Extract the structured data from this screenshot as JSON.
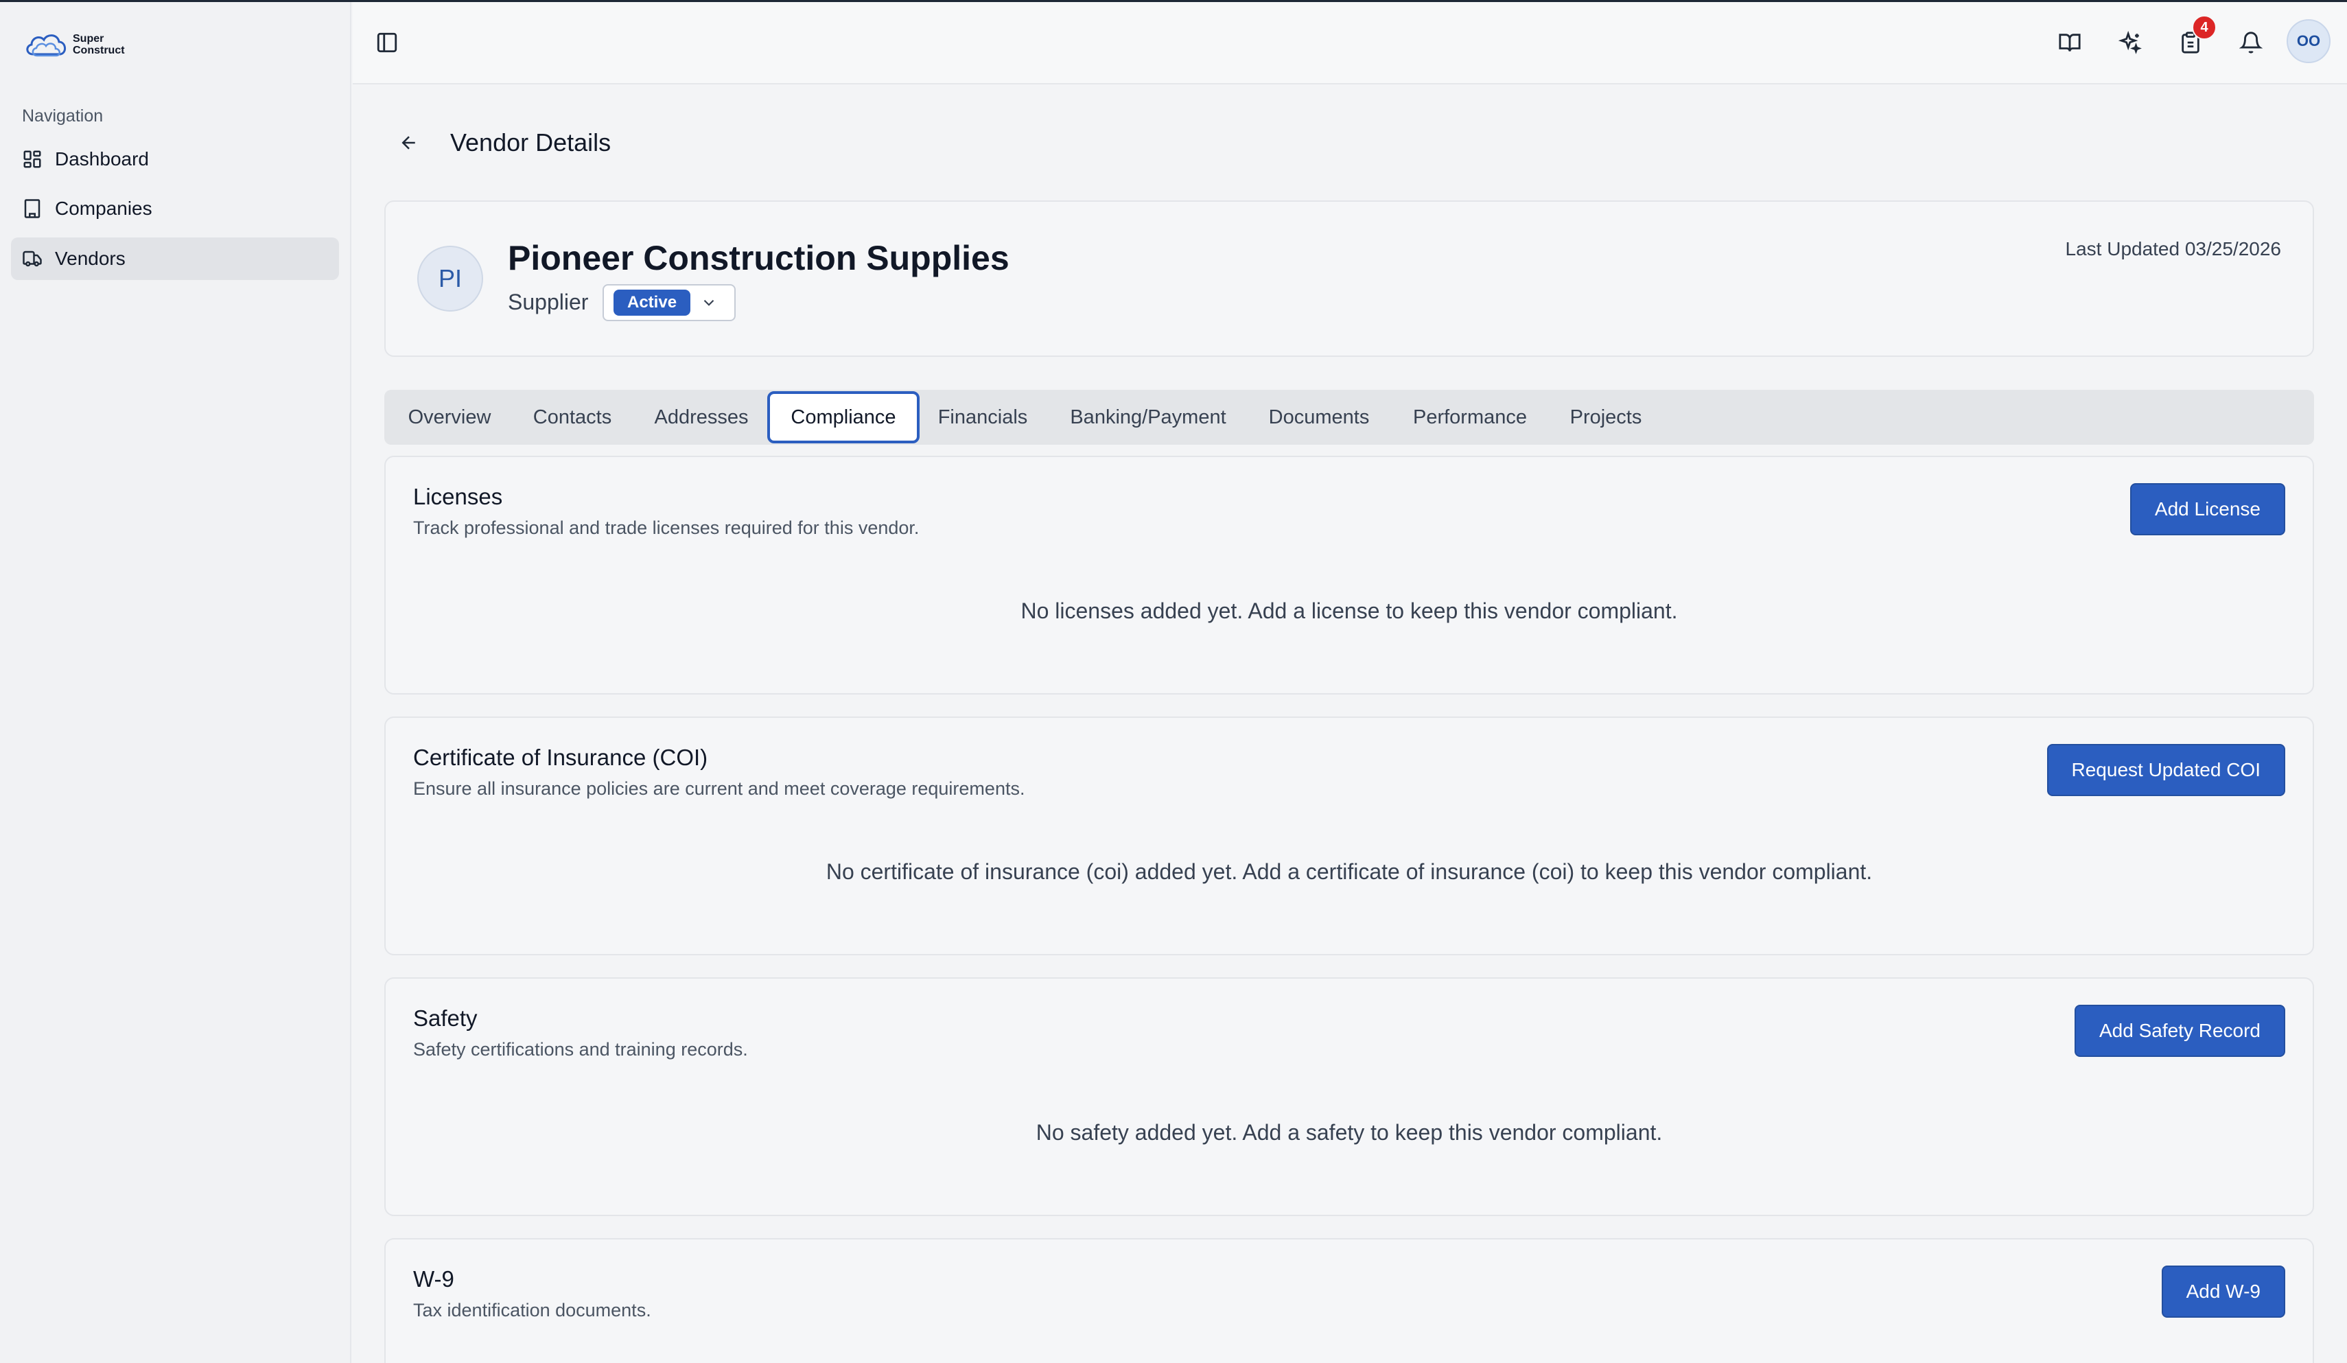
{
  "brand": {
    "line1": "Super",
    "line2": "Construct"
  },
  "sidebar": {
    "heading": "Navigation",
    "items": [
      {
        "label": "Dashboard",
        "icon": "dashboard-icon"
      },
      {
        "label": "Companies",
        "icon": "building-icon"
      },
      {
        "label": "Vendors",
        "icon": "truck-icon",
        "active": true
      }
    ]
  },
  "header": {
    "icons": [
      "sidebar-toggle-icon",
      "book-icon",
      "sparkles-icon",
      "clipboard-icon",
      "bell-icon"
    ],
    "clipboard_badge": "4",
    "user_initials": "OO"
  },
  "page": {
    "title": "Vendor Details"
  },
  "vendor": {
    "initials": "PI",
    "name": "Pioneer Construction Supplies",
    "type": "Supplier",
    "status": "Active",
    "last_updated": "Last Updated 03/25/2026"
  },
  "tabs": [
    "Overview",
    "Contacts",
    "Addresses",
    "Compliance",
    "Financials",
    "Banking/Payment",
    "Documents",
    "Performance",
    "Projects"
  ],
  "active_tab": "Compliance",
  "sections": {
    "licenses": {
      "title": "Licenses",
      "description": "Track professional and trade licenses required for this vendor.",
      "button": "Add License",
      "empty": "No licenses added yet. Add a license to keep this vendor compliant."
    },
    "coi": {
      "title": "Certificate of Insurance (COI)",
      "description": "Ensure all insurance policies are current and meet coverage requirements.",
      "button": "Request Updated COI",
      "empty": "No certificate of insurance (coi) added yet. Add a certificate of insurance (coi) to keep this vendor compliant."
    },
    "safety": {
      "title": "Safety",
      "description": "Safety certifications and training records.",
      "button": "Add Safety Record",
      "empty": "No safety added yet. Add a safety to keep this vendor compliant."
    },
    "w9": {
      "title": "W-9",
      "description": "Tax identification documents.",
      "button": "Add W-9"
    }
  },
  "colors": {
    "primary": "#2b5ec0",
    "badge": "#dc2626",
    "background": "#f3f4f6"
  }
}
